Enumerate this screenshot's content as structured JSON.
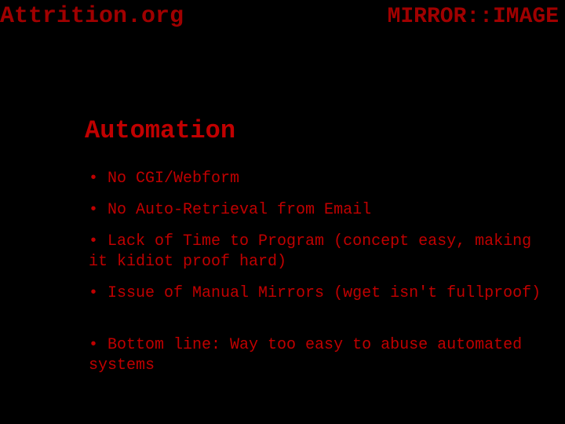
{
  "header": {
    "left": "Attrition.org",
    "right": "MIRROR::IMAGE"
  },
  "title": "Automation",
  "bullets": [
    {
      "text": "No CGI/Webform"
    },
    {
      "text": "No Auto-Retrieval from Email"
    },
    {
      "text": "Lack of Time to Program (concept easy, making it kidiot proof hard)"
    },
    {
      "text": "Issue of Manual Mirrors (wget isn't fullproof)"
    },
    {
      "text": "Bottom line: Way too easy to abuse automated systems"
    }
  ],
  "colors": {
    "background": "#000000",
    "header_text": "#a00000",
    "body_text": "#c00000"
  }
}
